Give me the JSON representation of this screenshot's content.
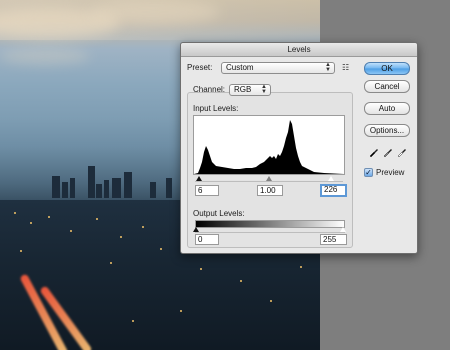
{
  "dialog": {
    "title": "Levels",
    "preset": {
      "label": "Preset:",
      "value": "Custom"
    },
    "channel": {
      "label": "Channel:",
      "value": "RGB"
    },
    "input_levels": {
      "label": "Input Levels:",
      "black": "6",
      "midtone": "1.00",
      "white": "226"
    },
    "output_levels": {
      "label": "Output Levels:",
      "black": "0",
      "white": "255"
    },
    "buttons": {
      "ok": "OK",
      "cancel": "Cancel",
      "auto": "Auto",
      "options": "Options..."
    },
    "preview": {
      "label": "Preview",
      "checked": true
    }
  },
  "icons": {
    "preset_menu": "preset-options-icon",
    "droppers": [
      "black-point-eyedropper-icon",
      "gray-point-eyedropper-icon",
      "white-point-eyedropper-icon"
    ],
    "checkmark": "✓"
  },
  "colors": {
    "default_button": "#4b9de4",
    "focus_ring": "#5d98d6",
    "histogram_fill": "#000000"
  }
}
